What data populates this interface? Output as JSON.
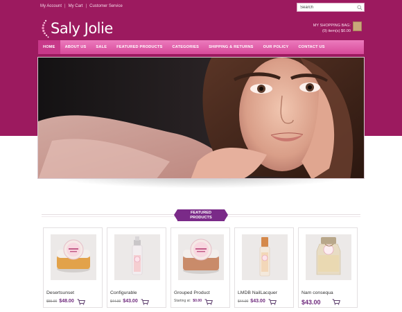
{
  "top_links": {
    "account": "My Account",
    "cart": "My Cart",
    "service": "Customer Service",
    "separator": "|"
  },
  "search": {
    "placeholder": "Search"
  },
  "logo": {
    "text": "Saly Jolie"
  },
  "shopping_bag": {
    "title": "MY SHOPPING BAG:",
    "summary": "(0) item(s) $0.00"
  },
  "nav": {
    "items": [
      {
        "label": "HOME"
      },
      {
        "label": "ABOUT US"
      },
      {
        "label": "SALE"
      },
      {
        "label": "FEATURED PRODUCTS"
      },
      {
        "label": "CATEGORIES"
      },
      {
        "label": "SHIPPING & RETURNS"
      },
      {
        "label": "OUR POLICY"
      },
      {
        "label": "CONTACT US"
      }
    ]
  },
  "featured": {
    "line1": "FEATURED",
    "line2": "PRODUCTS"
  },
  "products": [
    {
      "name": "Desertsunset",
      "old_price": "$55.00",
      "price": "$48.00",
      "lid_color": "#e2a24a"
    },
    {
      "name": "Configurable",
      "old_price": "$44.00",
      "price": "$43.00",
      "lid_color": "#c9c6c8"
    },
    {
      "name": "Grouped Product",
      "starting_label": "Starting at:",
      "price": "$0.00",
      "lid_color": "#c98b6a"
    },
    {
      "name": "LMDB NailLacquer",
      "old_price": "$44.00",
      "price": "$43.00",
      "lid_color": "#d5894a"
    },
    {
      "name": "Nam consequa",
      "price": "$43.00",
      "lid_color": "#b8a78a"
    }
  ],
  "colors": {
    "brand_magenta": "#9c1a5f",
    "nav_pink": "#e0609f",
    "price_purple": "#6f2a7d",
    "tag_purple": "#7a2a88"
  }
}
